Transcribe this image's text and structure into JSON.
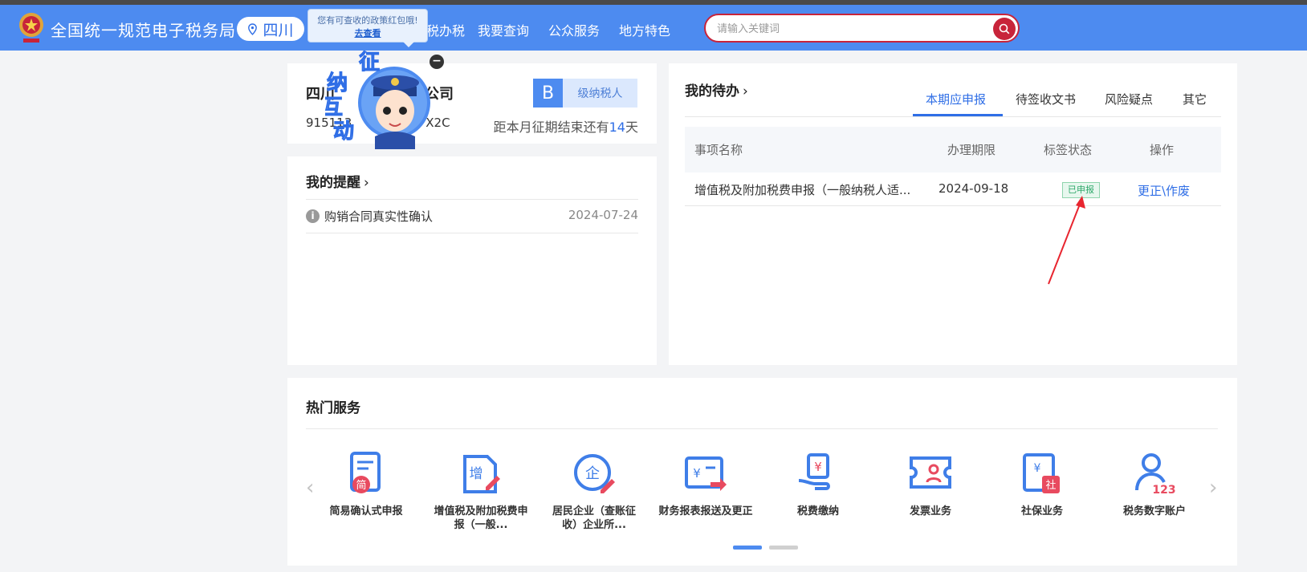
{
  "header": {
    "site_title": "全国统一规范电子税务局",
    "region": "四川",
    "nav": [
      "我要办税",
      "我要查询",
      "公众服务",
      "地方特色"
    ],
    "nav_partial_first": "税办税",
    "search_placeholder": "请输入关键词",
    "brand_color": "#4d8bf0",
    "search_accent": "#c8243a"
  },
  "tooltip": {
    "text": "您有可查收的政策红包哦!",
    "link": "去查看"
  },
  "mascot": {
    "chars": [
      "征",
      "纳",
      "互",
      "动"
    ]
  },
  "company": {
    "name_left": "四川",
    "name_right": "限公司",
    "id_left": "915113",
    "id_right": "X2C",
    "grade": "B",
    "grade_label": "级纳税人",
    "deadline_prefix": "距本月征期结束还有",
    "deadline_days": "14",
    "deadline_suffix": "天"
  },
  "reminders": {
    "title": "我的提醒",
    "items": [
      {
        "text": "购销合同真实性确认",
        "date": "2024-07-24"
      }
    ]
  },
  "todo": {
    "title": "我的待办",
    "tabs": [
      "本期应申报",
      "待签收文书",
      "风险疑点",
      "其它"
    ],
    "active_tab": 0,
    "columns": [
      "事项名称",
      "办理期限",
      "标签状态",
      "操作"
    ],
    "rows": [
      {
        "name": "增值税及附加税费申报（一般纳税人适...",
        "deadline": "2024-09-18",
        "status": "已申报",
        "action": "更正\\作废"
      }
    ]
  },
  "hot_services": {
    "title": "热门服务",
    "items": [
      {
        "label": "简易确认式申报",
        "icon": "simple-declare-icon"
      },
      {
        "label": "增值税及附加税费申报（一般...",
        "icon": "vat-declare-icon"
      },
      {
        "label": "居民企业（查账征收）企业所...",
        "icon": "enterprise-income-icon"
      },
      {
        "label": "财务报表报送及更正",
        "icon": "financial-report-icon"
      },
      {
        "label": "税费缴纳",
        "icon": "tax-payment-icon"
      },
      {
        "label": "发票业务",
        "icon": "invoice-icon"
      },
      {
        "label": "社保业务",
        "icon": "social-security-icon"
      },
      {
        "label": "税务数字账户",
        "icon": "digital-account-icon"
      }
    ],
    "badge_text": {
      "simple": "简",
      "vat": "增",
      "enterprise": "企",
      "social": "社",
      "account": "123"
    }
  }
}
